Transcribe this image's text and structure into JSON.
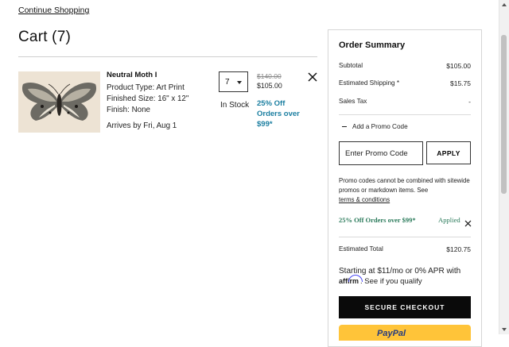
{
  "nav": {
    "continue_shopping": "Continue Shopping"
  },
  "cart": {
    "title": "Cart (7)",
    "item": {
      "name": "Neutral Moth I",
      "product_type": "Product Type: Art Print",
      "finished_size": "Finished Size: 16\" x 12\"",
      "finish": "Finish: None",
      "arrives": "Arrives by Fri, Aug 1",
      "quantity": "7",
      "stock": "In Stock",
      "original_price": "$140.00",
      "price": "$105.00",
      "promo": "25% Off Orders over $99*",
      "image_icon": "moth-artwork-image",
      "remove_icon": "close-icon"
    }
  },
  "summary": {
    "title": "Order Summary",
    "subtotal_label": "Subtotal",
    "subtotal_value": "$105.00",
    "shipping_label": "Estimated Shipping *",
    "shipping_value": "$15.75",
    "tax_label": "Sales Tax",
    "tax_value": "-",
    "add_promo_label": "Add a Promo Code",
    "promo_placeholder": "Enter Promo Code",
    "apply_label": "APPLY",
    "promo_note": "Promo codes cannot be combined with sitewide promos or markdown items. See",
    "terms_label": "terms & conditions",
    "applied_promo": "25% Off Orders over $99*",
    "applied_status": "Applied",
    "estimated_total_label": "Estimated Total",
    "estimated_total_value": "$120.75",
    "affirm_line1": "Starting at $11/mo or 0% APR with",
    "affirm_brand": "affirm",
    "affirm_link": "See if you qualify",
    "checkout_label": "SECURE CHECKOUT",
    "paypal_label": "PayPal"
  },
  "colors": {
    "accent_teal": "#1a7ea0",
    "applied_green": "#2a7a5a",
    "checkout_black": "#0a0a0a",
    "paypal_yellow": "#ffc439"
  }
}
